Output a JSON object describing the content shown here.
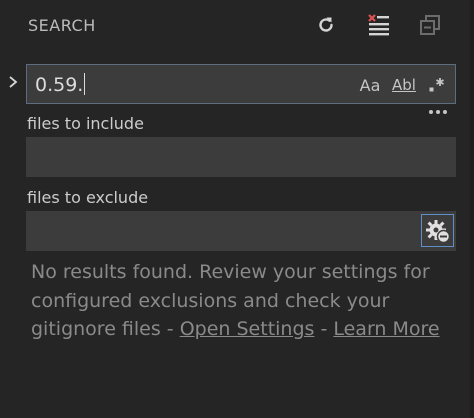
{
  "header": {
    "title": "SEARCH",
    "icons": [
      "refresh-icon",
      "clear-results-icon",
      "collapse-all-icon"
    ]
  },
  "search": {
    "value": "0.59.",
    "options": {
      "match_case": "Aa",
      "whole_word": "Abl",
      "regex": ".*"
    }
  },
  "include": {
    "label": "files to include",
    "value": "",
    "placeholder": ""
  },
  "exclude": {
    "label": "files to exclude",
    "value": "",
    "placeholder": ""
  },
  "message": {
    "text_before": "No results found. Review your settings for configured exclusions and check your gitignore files - ",
    "open_settings": "Open Settings",
    "separator": " - ",
    "learn_more": "Learn More"
  },
  "colors": {
    "background": "#252526",
    "input_background": "#3c3c3c",
    "focus_border": "#5e6c80",
    "muted_text": "#8a8a8a"
  }
}
